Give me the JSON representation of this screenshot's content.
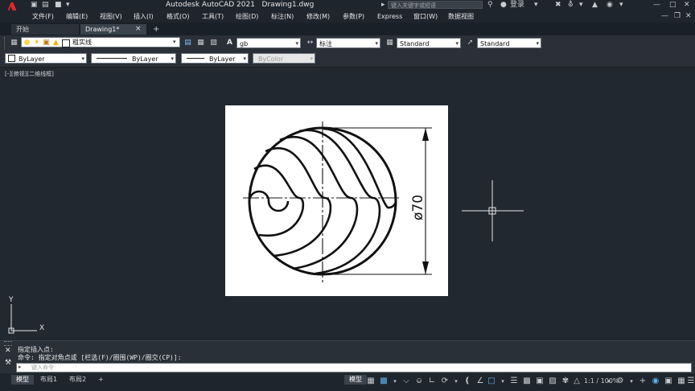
{
  "title_bar": {
    "app_name": "Autodesk AutoCAD 2021",
    "file_name": "Drawing1.dwg",
    "search_placeholder": "键入关键字或短语",
    "login_label": "登录"
  },
  "menu": {
    "items": [
      "文件(F)",
      "编辑(E)",
      "视图(V)",
      "插入(I)",
      "格式(O)",
      "工具(T)",
      "绘图(D)",
      "标注(N)",
      "修改(M)",
      "参数(P)",
      "Express",
      "窗口(W)",
      "数据视图"
    ]
  },
  "tabs": {
    "items": [
      "开始",
      "Drawing1*"
    ],
    "close_glyph": "×",
    "add_glyph": "+"
  },
  "toolbar1": {
    "layer": "粗实线",
    "text_style": "gb",
    "dim_style": "标注",
    "table_style": "Standard",
    "multileader_style": "Standard"
  },
  "toolbar2": {
    "color": "ByLayer",
    "linetype": "ByLayer",
    "lineweight": "ByLayer",
    "plot_style": "ByColor"
  },
  "viewport": {
    "view_label": "[-][俯视][二维线框]",
    "dimension_text": "ø70",
    "ucs_y": "Y",
    "ucs_x": "X"
  },
  "command": {
    "line1": "指定插入点:",
    "line2": "命令: 指定对角点或 [栏选(F)/圈围(WP)/圈交(CP)]:",
    "input_placeholder": "键入命令"
  },
  "status": {
    "layout_tabs": [
      "模型",
      "布局1",
      "布局2"
    ],
    "add_glyph": "+",
    "model_label": "模型",
    "scale_label": "1:1 / 100%"
  },
  "colors": {
    "accent": "#5fb4f0",
    "logo_red": "#e8262a",
    "canvas": "#212830"
  }
}
